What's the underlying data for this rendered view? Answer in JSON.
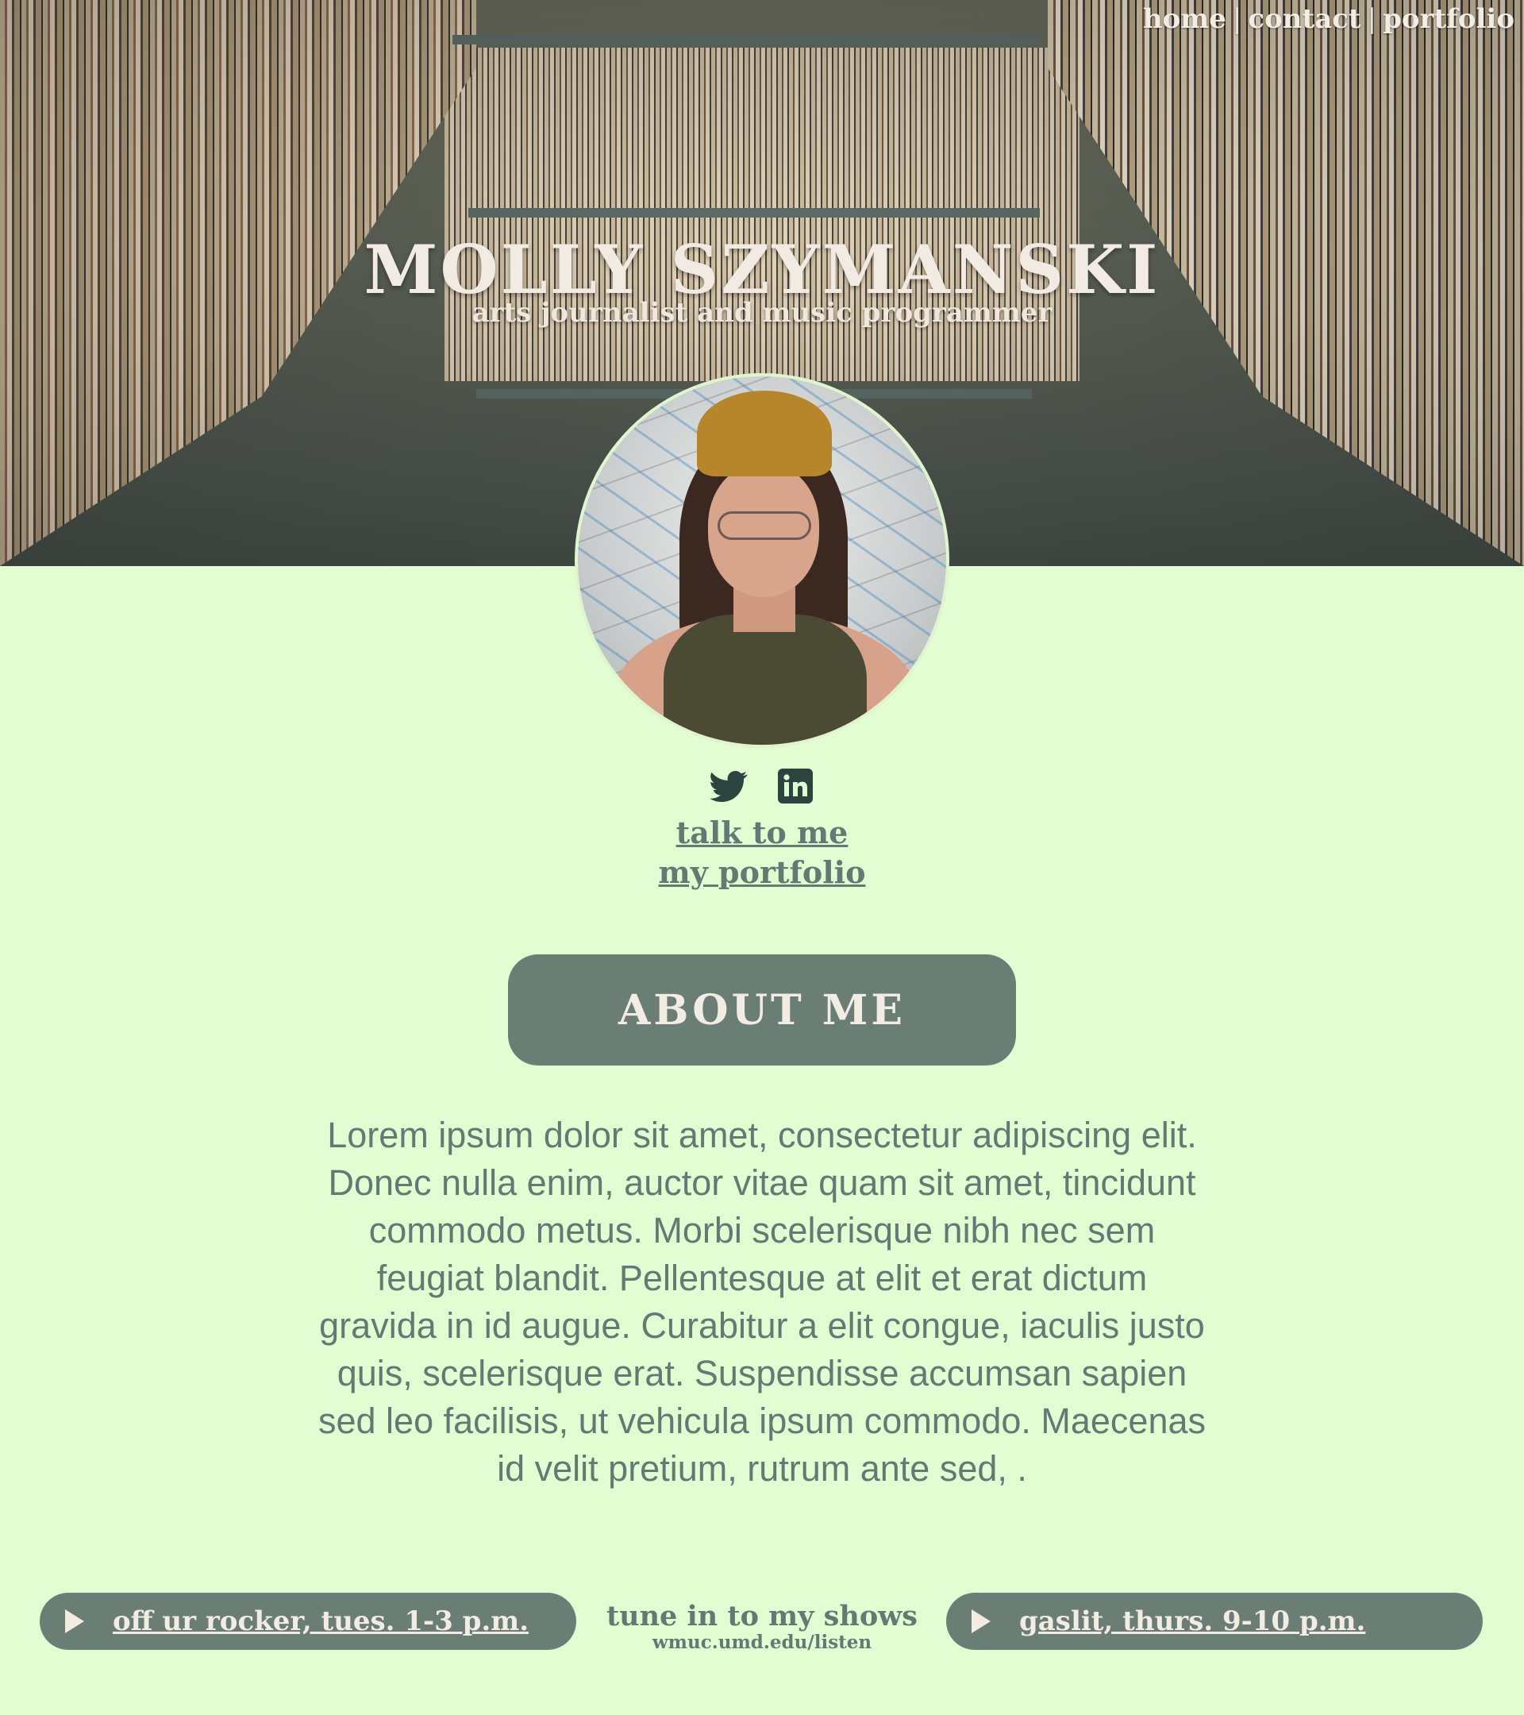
{
  "nav": {
    "items": [
      {
        "label": "home"
      },
      {
        "label": "contact"
      },
      {
        "label": "portfolio"
      }
    ],
    "separator": "|"
  },
  "hero": {
    "name": "MOLLY SZYMANSKI",
    "tagline": "arts journalist and music programmer"
  },
  "social": {
    "icons": [
      "twitter-icon",
      "linkedin-icon"
    ]
  },
  "links": {
    "contact": "talk to me",
    "portfolio": "my portfolio"
  },
  "about": {
    "heading": "ABOUT ME",
    "body": "Lorem ipsum dolor sit amet, consectetur adipiscing elit. Donec nulla enim, auctor vitae quam sit amet, tincidunt commodo metus. Morbi scelerisque nibh nec sem feugiat blandit. Pellentesque at elit et erat dictum gravida in id augue. Curabitur a elit congue, iaculis justo quis, scelerisque erat. Suspendisse accumsan sapien sed leo facilisis, ut vehicula ipsum commodo. Maecenas id velit pretium, rutrum ante sed, ."
  },
  "shows": {
    "left": "off ur rocker, tues. 1-3 p.m.",
    "right": "gaslit, thurs. 9-10 p.m.",
    "tune_title": "tune in to my shows",
    "tune_url": "wmuc.umd.edu/listen"
  },
  "colors": {
    "background": "#e2fdd2",
    "accent": "#6b7e76",
    "link": "#617b74",
    "light_text": "#f3ece2"
  }
}
